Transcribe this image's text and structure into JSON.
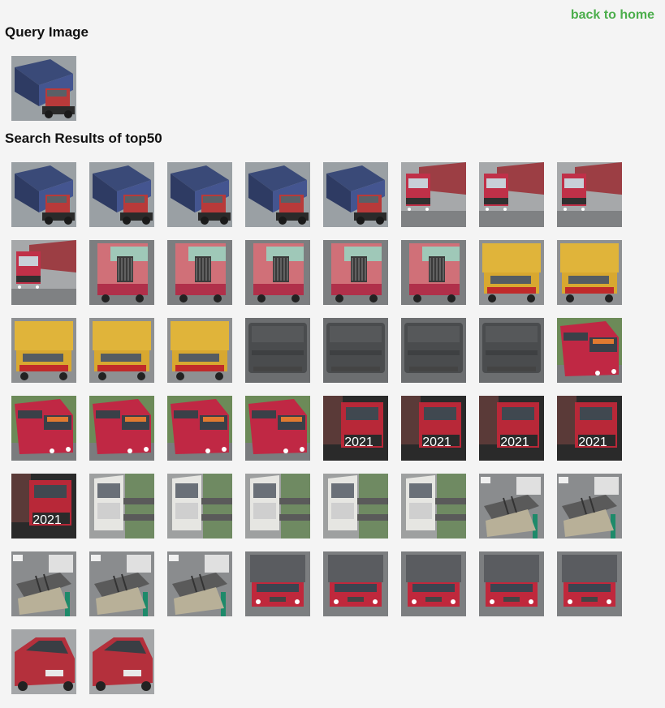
{
  "nav": {
    "back_label": "back to home"
  },
  "query": {
    "title": "Query Image",
    "image": {
      "kind": "container-blue"
    }
  },
  "results": {
    "title": "Search Results of top50",
    "items": [
      {
        "kind": "container-blue"
      },
      {
        "kind": "container-blue"
      },
      {
        "kind": "container-blue"
      },
      {
        "kind": "container-blue"
      },
      {
        "kind": "container-blue"
      },
      {
        "kind": "container-red"
      },
      {
        "kind": "container-red"
      },
      {
        "kind": "container-red"
      },
      {
        "kind": "container-red"
      },
      {
        "kind": "cargo-cage"
      },
      {
        "kind": "cargo-cage"
      },
      {
        "kind": "cargo-cage"
      },
      {
        "kind": "cargo-cage"
      },
      {
        "kind": "cargo-cage"
      },
      {
        "kind": "yellow-box"
      },
      {
        "kind": "yellow-box"
      },
      {
        "kind": "yellow-box"
      },
      {
        "kind": "yellow-box"
      },
      {
        "kind": "yellow-box"
      },
      {
        "kind": "blurry-gray"
      },
      {
        "kind": "blurry-gray"
      },
      {
        "kind": "blurry-gray"
      },
      {
        "kind": "blurry-gray"
      },
      {
        "kind": "bus-red"
      },
      {
        "kind": "bus-red"
      },
      {
        "kind": "bus-red"
      },
      {
        "kind": "bus-red"
      },
      {
        "kind": "bus-red"
      },
      {
        "kind": "red-truck-2021",
        "label": "2021"
      },
      {
        "kind": "red-truck-2021",
        "label": "2021"
      },
      {
        "kind": "red-truck-2021",
        "label": "2021"
      },
      {
        "kind": "red-truck-2021",
        "label": "2021"
      },
      {
        "kind": "red-truck-2021",
        "label": "2021"
      },
      {
        "kind": "white-cab"
      },
      {
        "kind": "white-cab"
      },
      {
        "kind": "white-cab"
      },
      {
        "kind": "white-cab"
      },
      {
        "kind": "white-cab"
      },
      {
        "kind": "flatbed"
      },
      {
        "kind": "flatbed"
      },
      {
        "kind": "flatbed"
      },
      {
        "kind": "flatbed"
      },
      {
        "kind": "flatbed"
      },
      {
        "kind": "red-van-truck"
      },
      {
        "kind": "red-van-truck"
      },
      {
        "kind": "red-van-truck"
      },
      {
        "kind": "red-van-truck"
      },
      {
        "kind": "red-van-truck"
      },
      {
        "kind": "red-car"
      },
      {
        "kind": "red-car"
      }
    ]
  },
  "colors": {
    "link": "#4cae4c",
    "background": "#f4f4f4"
  }
}
